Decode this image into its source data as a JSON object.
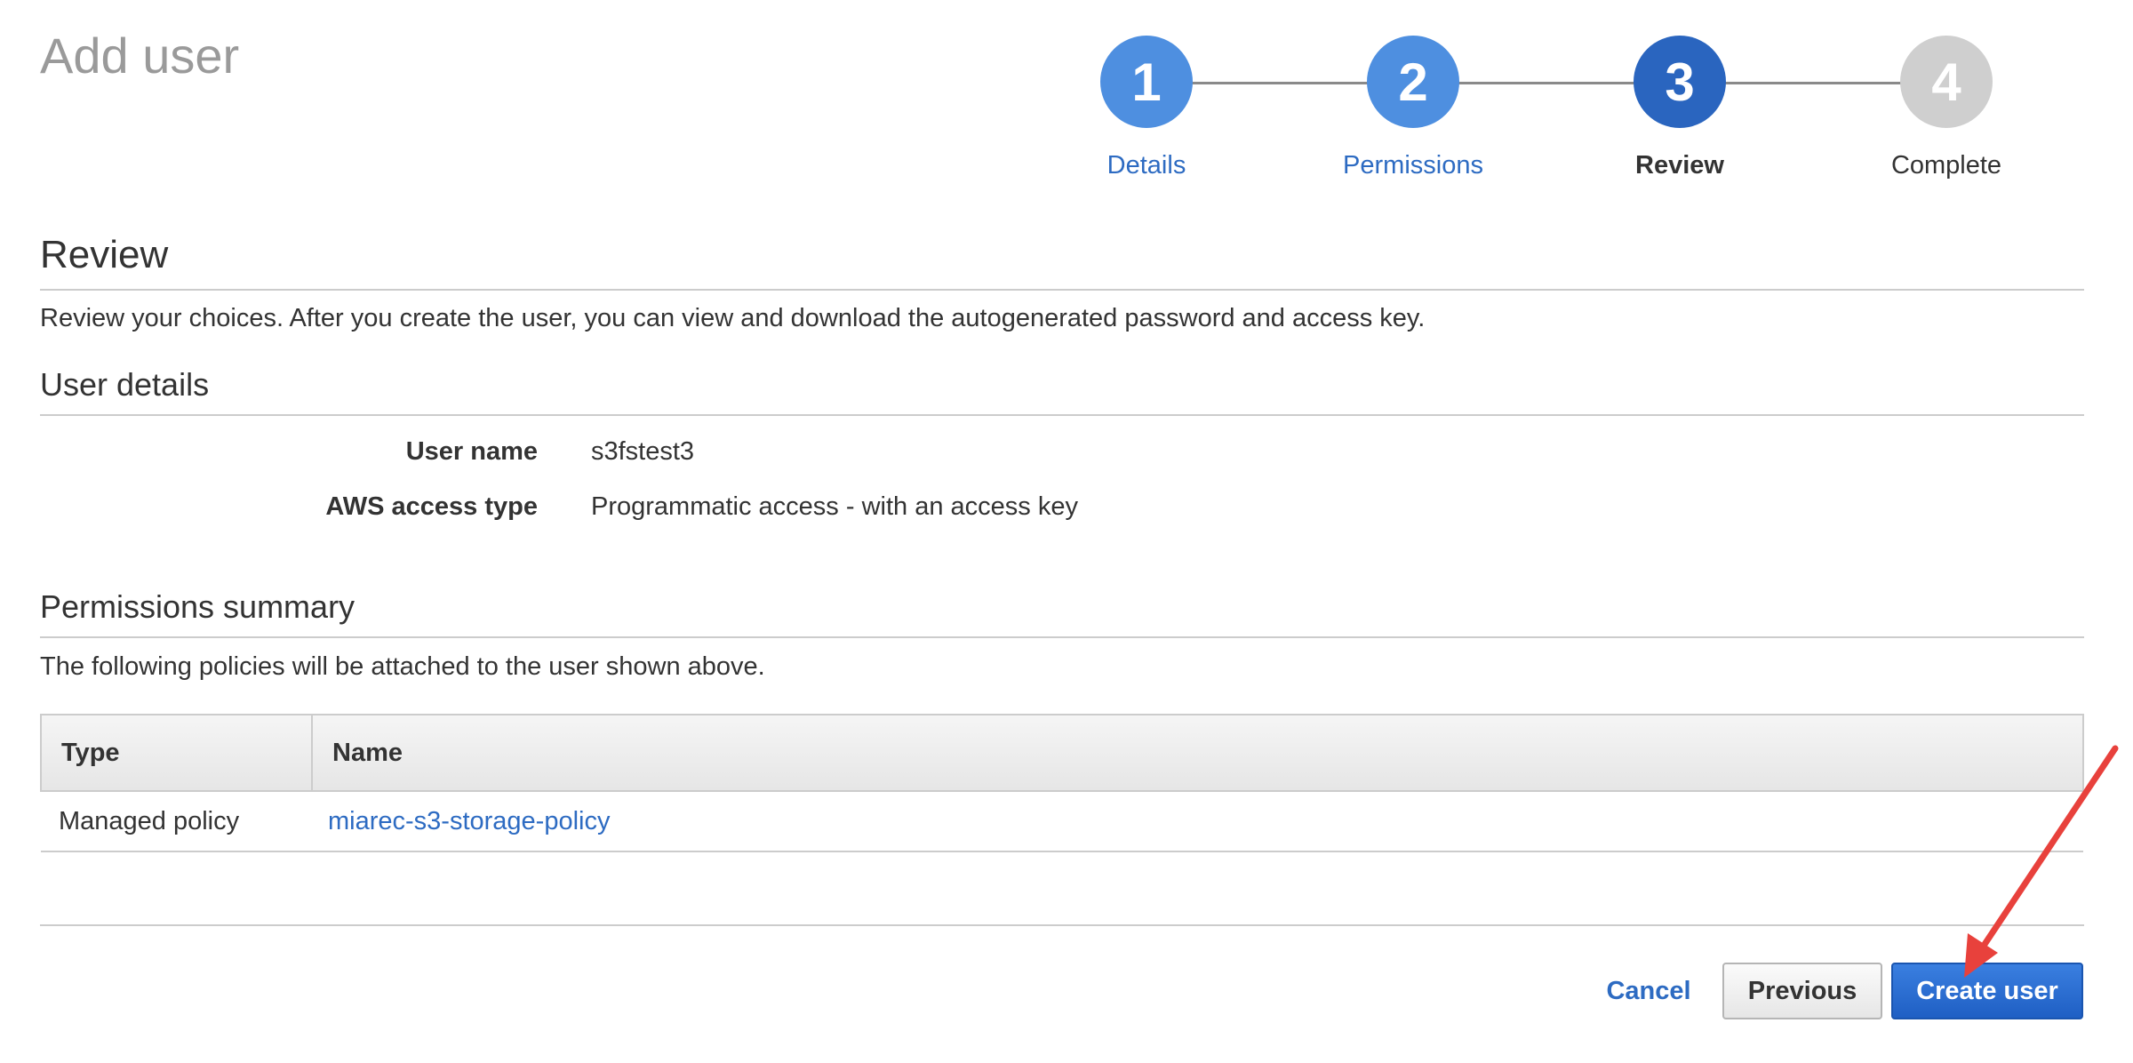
{
  "page": {
    "title": "Add user"
  },
  "stepper": {
    "steps": [
      {
        "number": "1",
        "label": "Details",
        "state": "done"
      },
      {
        "number": "2",
        "label": "Permissions",
        "state": "done"
      },
      {
        "number": "3",
        "label": "Review",
        "state": "current"
      },
      {
        "number": "4",
        "label": "Complete",
        "state": "future"
      }
    ]
  },
  "review": {
    "heading": "Review",
    "description": "Review your choices. After you create the user, you can view and download the autogenerated password and access key."
  },
  "user_details": {
    "heading": "User details",
    "rows": [
      {
        "label": "User name",
        "value": "s3fstest3"
      },
      {
        "label": "AWS access type",
        "value": "Programmatic access - with an access key"
      }
    ]
  },
  "permissions": {
    "heading": "Permissions summary",
    "description": "The following policies will be attached to the user shown above.",
    "columns": [
      "Type",
      "Name"
    ],
    "rows": [
      {
        "type": "Managed policy",
        "name": "miarec-s3-storage-policy"
      }
    ]
  },
  "footer": {
    "cancel_label": "Cancel",
    "previous_label": "Previous",
    "create_label": "Create user"
  },
  "colors": {
    "step_done": "#4e8fe0",
    "step_current": "#2a65bf",
    "step_future": "#cfcfcf",
    "link": "#2d6bc2",
    "primary_button": "#1f5fc4",
    "annotation_arrow": "#e8413c"
  }
}
